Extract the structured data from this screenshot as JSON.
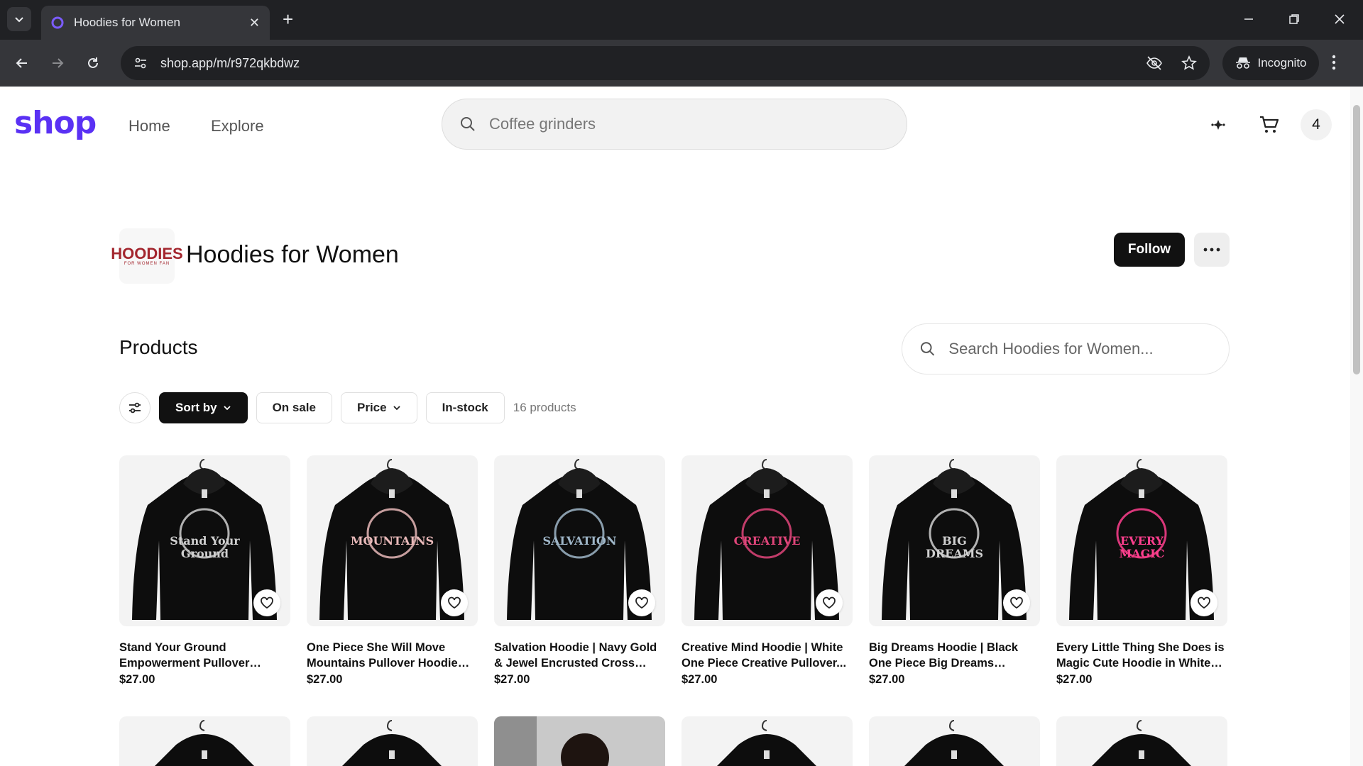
{
  "browser": {
    "tab_title": "Hoodies for Women",
    "url": "shop.app/m/r972qkbdwz",
    "incognito_label": "Incognito"
  },
  "header": {
    "logo": "shop",
    "nav": [
      "Home",
      "Explore"
    ],
    "search_placeholder": "Coffee grinders",
    "cart_count": "4"
  },
  "store": {
    "logo_text": "HOODIES",
    "logo_sub": "FOR WOMEN FAN",
    "name": "Hoodies for Women",
    "follow_label": "Follow"
  },
  "products": {
    "title": "Products",
    "search_placeholder": "Search Hoodies for Women...",
    "filters": {
      "sort_by": "Sort by",
      "on_sale": "On sale",
      "price": "Price",
      "in_stock": "In-stock"
    },
    "count_label": "16 products",
    "items": [
      {
        "name": "Stand Your Ground Empowerment Pullover Hoodi...",
        "price": "$27.00",
        "art": "Stand Your Ground",
        "art_color": "#cfcfcf"
      },
      {
        "name": "One Piece She Will Move Mountains Pullover Hoodie in...",
        "price": "$27.00",
        "art": "MOUNTAINS",
        "art_color": "#e8b9b9"
      },
      {
        "name": "Salvation Hoodie | Navy Gold & Jewel Encrusted Cross Hoodi...",
        "price": "$27.00",
        "art": "SALVATION",
        "art_color": "#9fb6c8"
      },
      {
        "name": "Creative Mind Hoodie | White One Piece Creative Pullover...",
        "price": "$27.00",
        "art": "CREATIVE",
        "art_color": "#e0457a"
      },
      {
        "name": "Big Dreams Hoodie | Black One Piece Big Dreams Hooded...",
        "price": "$27.00",
        "art": "BIG DREAMS",
        "art_color": "#d0d0d0"
      },
      {
        "name": "Every Little Thing She Does is Magic Cute Hoodie in White f...",
        "price": "$27.00",
        "art": "EVERY MAGIC",
        "art_color": "#ff3f8e"
      }
    ]
  },
  "colors": {
    "brand": "#5a31f4",
    "chrome_dark": "#202124",
    "chrome_mid": "#35363a"
  }
}
